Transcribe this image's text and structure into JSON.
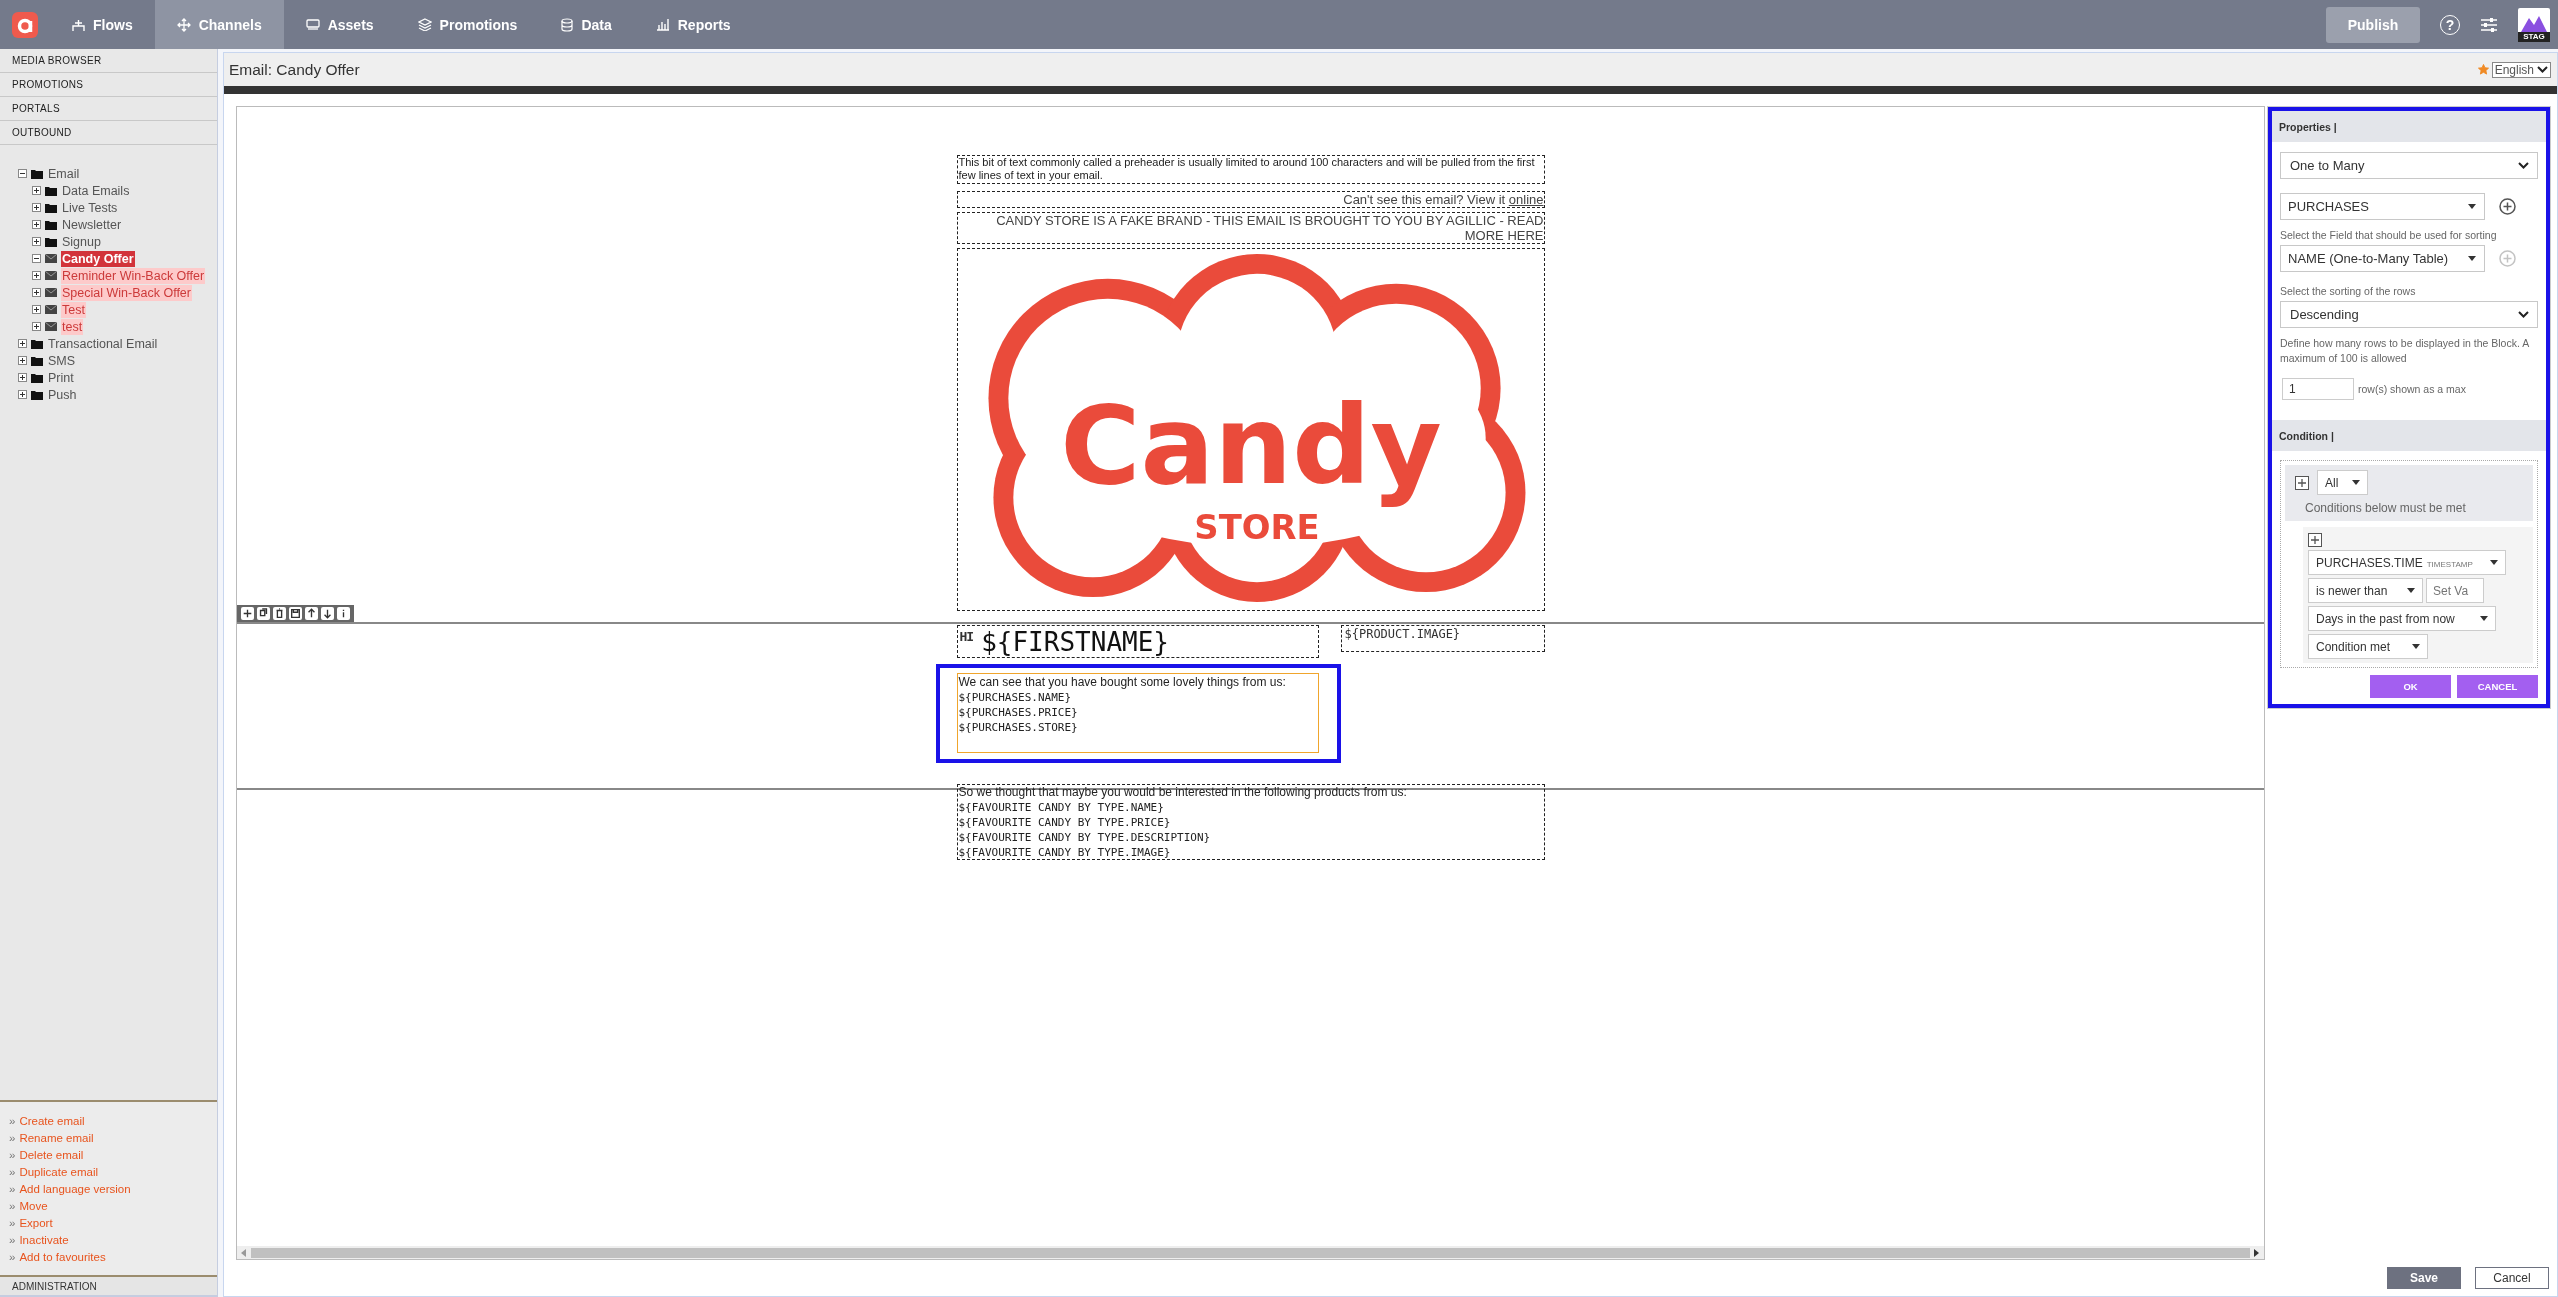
{
  "nav": {
    "items": [
      {
        "label": "Flows",
        "selected": false
      },
      {
        "label": "Channels",
        "selected": true
      },
      {
        "label": "Assets",
        "selected": false
      },
      {
        "label": "Promotions",
        "selected": false
      },
      {
        "label": "Data",
        "selected": false
      },
      {
        "label": "Reports",
        "selected": false
      }
    ],
    "publish": "Publish",
    "help_glyph": "?",
    "env_badge": "STAG"
  },
  "sidebar": {
    "sections": [
      "MEDIA BROWSER",
      "PROMOTIONS",
      "PORTALS",
      "OUTBOUND"
    ],
    "tree": [
      {
        "label": "Email",
        "kind": "folder",
        "expanded": true,
        "selected": false,
        "children": [
          {
            "label": "Data Emails",
            "kind": "folder",
            "expanded": false,
            "selected": false
          },
          {
            "label": "Live Tests",
            "kind": "folder",
            "expanded": false,
            "selected": false
          },
          {
            "label": "Newsletter",
            "kind": "folder",
            "expanded": false,
            "selected": false
          },
          {
            "label": "Signup",
            "kind": "folder",
            "expanded": false,
            "selected": false
          },
          {
            "label": "Candy Offer",
            "kind": "email",
            "expanded": true,
            "selected": true
          },
          {
            "label": "Reminder Win-Back Offer",
            "kind": "email",
            "expanded": false,
            "selected": false
          },
          {
            "label": "Special Win-Back Offer",
            "kind": "email",
            "expanded": false,
            "selected": false
          },
          {
            "label": "Test",
            "kind": "email",
            "expanded": false,
            "selected": false
          },
          {
            "label": "test",
            "kind": "email",
            "expanded": false,
            "selected": false
          }
        ]
      },
      {
        "label": "Transactional Email",
        "kind": "folder",
        "expanded": false,
        "selected": false
      },
      {
        "label": "SMS",
        "kind": "folder",
        "expanded": false,
        "selected": false
      },
      {
        "label": "Print",
        "kind": "folder",
        "expanded": false,
        "selected": false
      },
      {
        "label": "Push",
        "kind": "folder",
        "expanded": false,
        "selected": false
      }
    ],
    "actions": [
      {
        "bullet": "»",
        "label": "Create email"
      },
      {
        "bullet": "»",
        "label": "Rename email"
      },
      {
        "bullet": "»",
        "label": "Delete email"
      },
      {
        "bullet": "»",
        "label": "Duplicate email"
      },
      {
        "bullet": "»",
        "label": "Add language version"
      },
      {
        "bullet": "»",
        "label": "Move"
      },
      {
        "bullet": "»",
        "label": "Export"
      },
      {
        "bullet": "»",
        "label": "Inactivate"
      },
      {
        "bullet": "»",
        "label": "Add to favourites"
      }
    ],
    "footer": "ADMINISTRATION"
  },
  "editor": {
    "title": "Email: Candy Offer",
    "favourite": true,
    "language": "English"
  },
  "email": {
    "preheader": "This bit of text commonly called a preheader is usually limited to around 100 characters and will be pulled from the first few lines of text in your email.",
    "view_online_prefix": "Can't see this email? View it ",
    "view_online_link": "online",
    "disclaimer": "CANDY STORE IS A FAKE BRAND - THIS EMAIL IS BROUGHT TO YOU BY AGILLIC - READ MORE HERE",
    "logo": {
      "word": "Candy",
      "tagline": "STORE"
    },
    "heading_marker": "HI",
    "heading": "${FIRSTNAME}",
    "product_image": "${PRODUCT.IMAGE}",
    "purchases": {
      "selected": true,
      "highlighted": true,
      "lines": [
        {
          "kind": "text",
          "text": "We can see that you have bought some lovely things from us:"
        },
        {
          "kind": "field",
          "text": "${PURCHASES.NAME}"
        },
        {
          "kind": "field",
          "text": "${PURCHASES.PRICE}"
        },
        {
          "kind": "field",
          "text": "${PURCHASES.STORE}"
        }
      ]
    },
    "recommendations": [
      {
        "kind": "text",
        "text": "So we thought that maybe you would be interested in the following products from us:"
      },
      {
        "kind": "field",
        "text": "${FAVOURITE CANDY BY TYPE.NAME}"
      },
      {
        "kind": "field",
        "text": "${FAVOURITE CANDY BY TYPE.PRICE}"
      },
      {
        "kind": "field",
        "text": "${FAVOURITE CANDY BY TYPE.DESCRIPTION}"
      },
      {
        "kind": "field",
        "text": "${FAVOURITE CANDY BY TYPE.IMAGE}"
      }
    ]
  },
  "panel": {
    "highlighted": true,
    "properties": {
      "title": "Properties |",
      "relation": "One to Many",
      "table": {
        "value": "PURCHASES",
        "add_disabled": false
      },
      "sort_field_hint": "Select the Field that should be used for sorting",
      "sort_field": {
        "value": "NAME (One-to-Many Table)",
        "add_disabled": true
      },
      "sort_order_hint": "Select the sorting of the rows",
      "sort_order": "Descending",
      "rows_hint": "Define how many rows to be displayed in the Block. A maximum of 100 is allowed",
      "rows_value": "1",
      "rows_suffix": "row(s) shown as a max"
    },
    "condition": {
      "title": "Condition |",
      "group_mode": "All",
      "group_hint": "Conditions below must be met",
      "field": "PURCHASES.TIME",
      "field_type": "TIMESTAMP",
      "operator": "is newer than",
      "value_placeholder": "Set Va",
      "unit": "Days in the past from now",
      "result": "Condition met"
    },
    "ok": "OK",
    "cancel": "CANCEL"
  },
  "footer": {
    "save": "Save",
    "cancel": "Cancel"
  }
}
